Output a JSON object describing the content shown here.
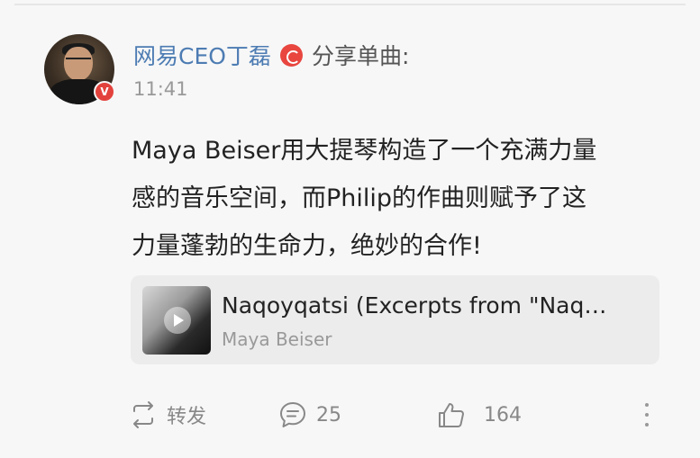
{
  "post": {
    "author": "网易CEO丁磊",
    "share_label": "分享单曲:",
    "time": "11:41",
    "verified_badge": "V",
    "text": "Maya Beiser用大提琴构造了一个充满力量感的音乐空间，而Philip的作曲则赋予了这力量蓬勃的生命力，绝妙的合作!",
    "text_lines": [
      "Maya Beiser用大提琴构造了一个充满力量",
      "感的音乐空间，而Philip的作曲则赋予了这",
      "力量蓬勃的生命力，绝妙的合作!"
    ]
  },
  "music_card": {
    "title": "Naqoyqatsi (Excerpts from \"Naq…",
    "artist": "Maya Beiser"
  },
  "actions": {
    "repost_label": "转发",
    "comment_count": "25",
    "like_count": "164"
  },
  "colors": {
    "username": "#4d7cb3",
    "badge": "#e3423c",
    "music_icon": "#e8463f"
  }
}
